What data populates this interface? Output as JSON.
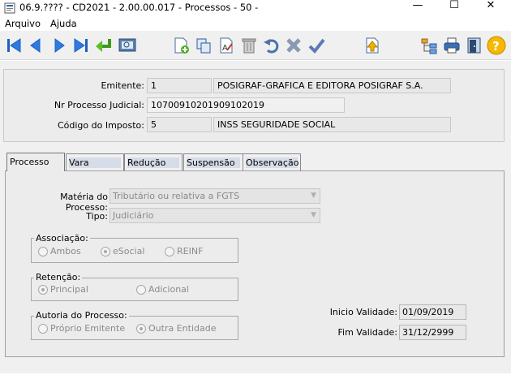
{
  "window": {
    "title": "06.9.???? - CD2021 - 2.00.00.017 - Processos - 50 -",
    "minimize": "—",
    "maximize": "☐",
    "close": "✕"
  },
  "menu": {
    "items": [
      "Arquivo",
      "Ajuda"
    ]
  },
  "header": {
    "emitente_label": "Emitente:",
    "emitente_code": "1",
    "emitente_name": "POSIGRAF-GRAFICA E EDITORA POSIGRAF S.A.",
    "processo_label": "Nr Processo Judicial:",
    "processo_value": "10700910201909102019",
    "imposto_label": "Código do Imposto:",
    "imposto_code": "5",
    "imposto_name": "INSS SEGURIDADE SOCIAL"
  },
  "tabs": [
    "Processo",
    "Vara",
    "Redução",
    "Suspensão",
    "Observação"
  ],
  "form": {
    "materia_label": "Matéria do Processo:",
    "materia_value": "Tributário ou relativa a FGTS",
    "tipo_label": "Tipo:",
    "tipo_value": "Judiciário",
    "associacao": {
      "title": "Associação:",
      "options": [
        "Ambos",
        "eSocial",
        "REINF"
      ],
      "selected": "eSocial"
    },
    "retencao": {
      "title": "Retenção:",
      "options": [
        "Principal",
        "Adicional"
      ],
      "selected": "Principal"
    },
    "autoria": {
      "title": "Autoria do Processo:",
      "options": [
        "Próprio Emitente",
        "Outra Entidade"
      ],
      "selected": "Outra Entidade"
    },
    "inicio_label": "Inicio Validade:",
    "inicio_value": "01/09/2019",
    "fim_label": "Fim Validade:",
    "fim_value": "31/12/2999"
  }
}
